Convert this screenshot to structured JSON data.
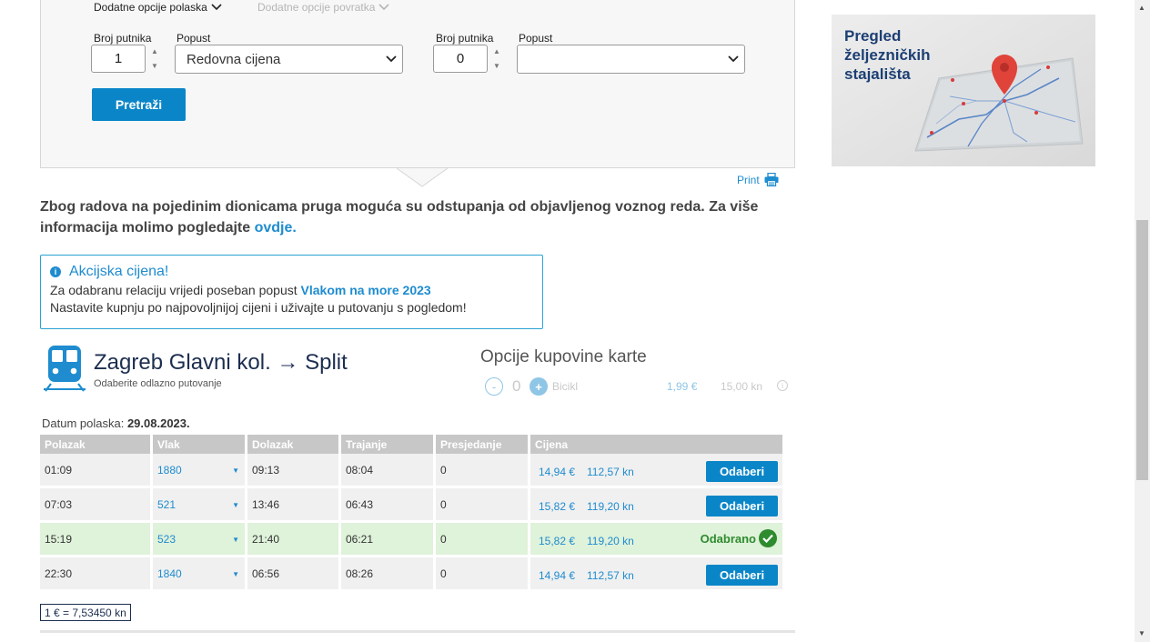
{
  "search_panel": {
    "options_departure_tab": "Dodatne opcije polaska",
    "options_return_tab": "Dodatne opcije povratka",
    "departure": {
      "passengers_label": "Broj putnika",
      "passengers_value": "1",
      "discount_label": "Popust",
      "discount_value": "Redovna cijena"
    },
    "return": {
      "passengers_label": "Broj putnika",
      "passengers_value": "0",
      "discount_label": "Popust",
      "discount_value": ""
    },
    "search_button": "Pretraži"
  },
  "print_label": "Print",
  "notice": {
    "text": "Zbog radova na pojedinim dionicama pruga moguća su odstupanja od objavljenog voznog reda. Za više informacija molimo pogledajte",
    "link": "ovdje."
  },
  "promo": {
    "title": "Akcijska cijena!",
    "line1_prefix": "Za odabranu relaciju vrijedi poseban popust",
    "line1_highlight": "Vlakom na more 2023",
    "line2": "Nastavite kupnju po najpovoljnijoj cijeni i uživajte u putovanju s pogledom!"
  },
  "route": {
    "title": "Zagreb Glavni kol. → Split",
    "subtitle": "Odaberite odlazno putovanje"
  },
  "ticket_options": {
    "title": "Opcije kupovine karte",
    "minus": "-",
    "plus": "+",
    "quantity": "0",
    "item": "Bicikl",
    "price_eur": "1,99 €",
    "price_kn": "15,00 kn",
    "info": "i"
  },
  "date": {
    "label": "Datum polaska:",
    "value": "29.08.2023."
  },
  "table": {
    "headers": [
      "Polazak",
      "Vlak",
      "Dolazak",
      "Trajanje",
      "Presjedanje",
      "Cijena"
    ],
    "rows": [
      {
        "departure": "01:09",
        "train": "1880",
        "arrival": "09:13",
        "duration": "08:04",
        "transfers": "0",
        "price_eur": "14,94 €",
        "price_kn": "112,57 kn",
        "action": "Odaberi",
        "selected": false
      },
      {
        "departure": "07:03",
        "train": "521",
        "arrival": "13:46",
        "duration": "06:43",
        "transfers": "0",
        "price_eur": "15,82 €",
        "price_kn": "119,20 kn",
        "action": "Odaberi",
        "selected": false
      },
      {
        "departure": "15:19",
        "train": "523",
        "arrival": "21:40",
        "duration": "06:21",
        "transfers": "0",
        "price_eur": "15,82 €",
        "price_kn": "119,20 kn",
        "action": "Odabrano",
        "selected": true
      },
      {
        "departure": "22:30",
        "train": "1840",
        "arrival": "06:56",
        "duration": "08:26",
        "transfers": "0",
        "price_eur": "14,94 €",
        "price_kn": "112,57 kn",
        "action": "Odaberi",
        "selected": false
      }
    ]
  },
  "exchange_rate": "1 € = 7,53450 kn",
  "side_card": {
    "line1": "Pregled",
    "line2": "željezničkih",
    "line3": "stajališta"
  },
  "colors": {
    "accent": "#0a86c8",
    "link": "#1e8ccf",
    "selected_row": "#dff2da",
    "selected_text": "#2e8b2e",
    "navy": "#1c2e50"
  }
}
